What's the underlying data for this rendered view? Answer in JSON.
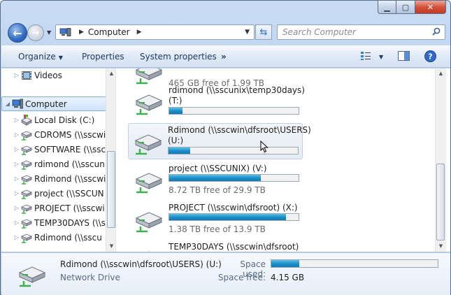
{
  "window": {
    "controls": {
      "minimize": "▁",
      "maximize": "▢",
      "close": "✕"
    }
  },
  "nav": {
    "breadcrumb": "Computer",
    "search_placeholder": "Search Computer"
  },
  "toolbar": {
    "organize": "Organize",
    "properties": "Properties",
    "system_properties": "System properties",
    "more": "»"
  },
  "sidebar": {
    "items": [
      {
        "label": "Videos",
        "icon": "film-icon"
      },
      {
        "label": "Computer",
        "icon": "computer-icon",
        "selected": true
      },
      {
        "label": "Local Disk (C:)",
        "icon": "local-disk-icon"
      },
      {
        "label": "CDROMS (\\\\sscwi",
        "icon": "network-drive-icon"
      },
      {
        "label": "SOFTWARE (\\\\ssc",
        "icon": "network-drive-icon"
      },
      {
        "label": "rdimond (\\\\sscun",
        "icon": "network-drive-icon"
      },
      {
        "label": "Rdimond (\\\\sscwi",
        "icon": "network-drive-icon"
      },
      {
        "label": "project (\\\\SSCUN",
        "icon": "network-drive-icon"
      },
      {
        "label": "PROJECT (\\\\sscwi",
        "icon": "network-drive-icon"
      },
      {
        "label": "TEMP30DAYS (\\\\s",
        "icon": "network-drive-icon"
      },
      {
        "label": "Rdimond (\\\\sscu",
        "icon": "network-drive-icon"
      }
    ]
  },
  "drives": [
    {
      "name": "",
      "sub": "",
      "free": "465 GB free of 1.99 TB",
      "fill": 0.23
    },
    {
      "name": "rdimond (\\\\sscunix\\temp30days)",
      "sub": "(T:)",
      "free": "",
      "fill": 0.1
    },
    {
      "name": "Rdimond (\\\\sscwin\\dfsroot\\USERS)",
      "sub": "(U:)",
      "free": "",
      "fill": 0.17,
      "selected": true
    },
    {
      "name": "project (\\\\SSCUNIX) (V:)",
      "sub": "",
      "free": "8.72 TB free of 29.9 TB",
      "fill": 0.71
    },
    {
      "name": "PROJECT (\\\\sscwin\\dfsroot) (X:)",
      "sub": "",
      "free": "1.38 TB free of 13.9 TB",
      "fill": 0.9
    },
    {
      "name": "TEMP30DAYS (\\\\sscwin\\dfsroot)",
      "sub": "",
      "free": "",
      "fill": 0
    }
  ],
  "details": {
    "name": "Rdimond (\\\\sscwin\\dfsroot\\USERS) (U:)",
    "type": "Network Drive",
    "space_used_label": "Space used:",
    "space_free_label": "Space free:",
    "space_free": "4.15 GB",
    "space_used_fill": 0.17
  },
  "colors": {
    "bar_fill": "#1a8fc9",
    "selection_border": "#84acdd",
    "toolbar_text": "#1e395b"
  }
}
